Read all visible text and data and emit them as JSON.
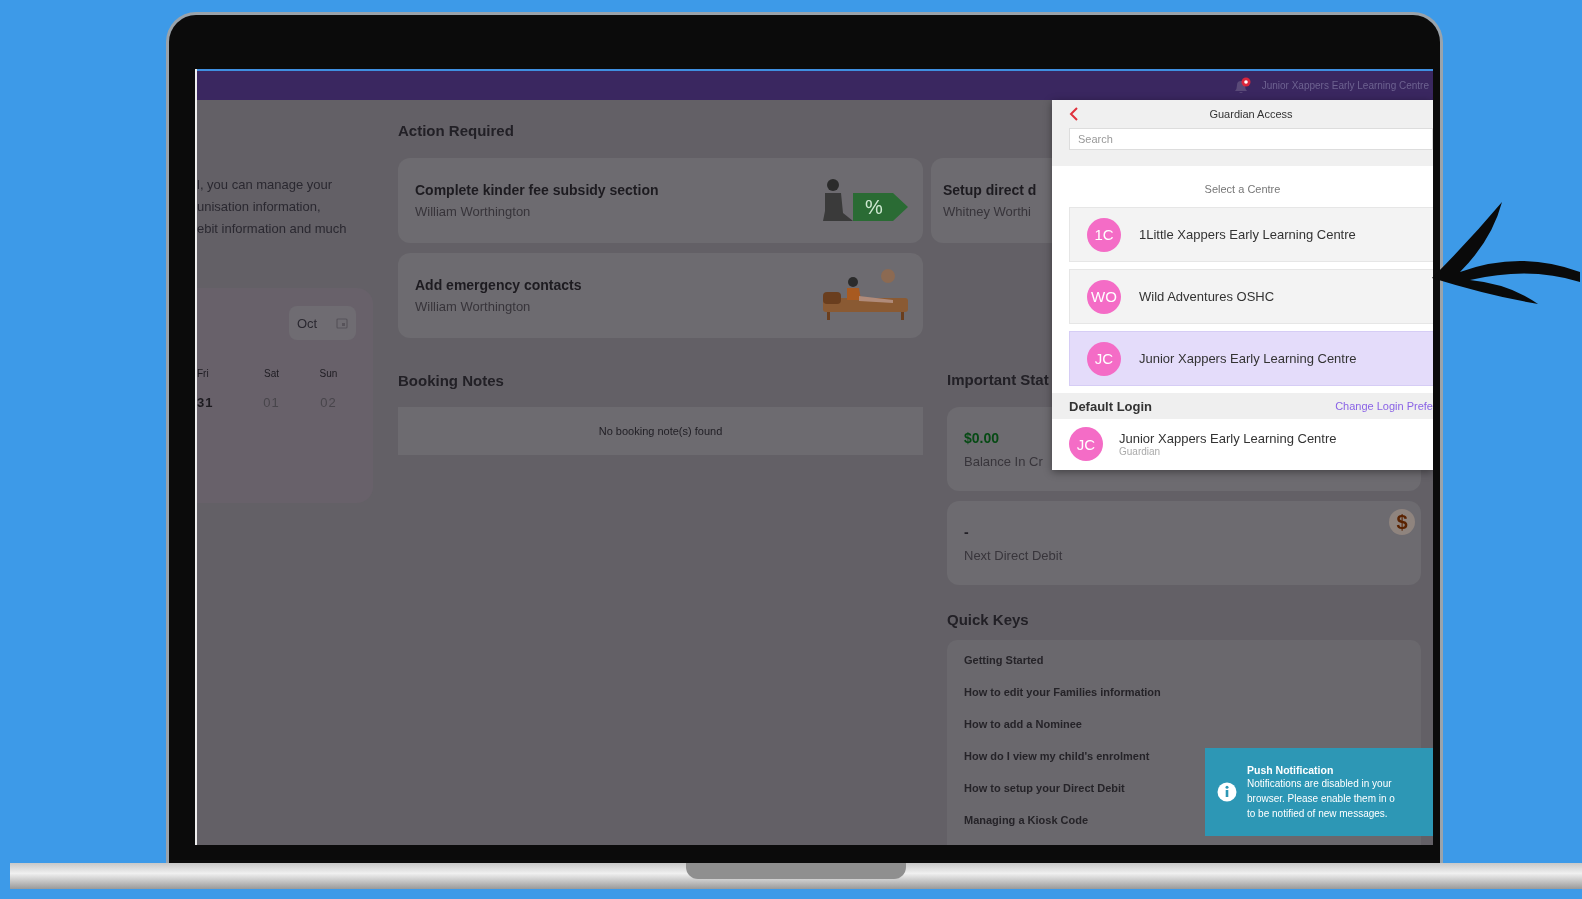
{
  "top_bar": {
    "centre_name": "Junior Xappers Early Learning Centre",
    "notification_badge": true
  },
  "intro_lines": [
    "l, you can manage your",
    "unisation information,",
    "ebit information and much"
  ],
  "calendar": {
    "month": "Oct",
    "days": [
      {
        "weekday": "Fri",
        "date": "31",
        "faded": false
      },
      {
        "weekday": "Sat",
        "date": "01",
        "faded": true
      },
      {
        "weekday": "Sun",
        "date": "02",
        "faded": true
      }
    ]
  },
  "action_required": {
    "title": "Action Required",
    "cards": [
      {
        "title": "Complete kinder fee subsidy section",
        "person": "William Worthington",
        "kind": "tag",
        "tag_text": "%"
      },
      {
        "title": "Setup direct d",
        "person": "Whitney Worthi",
        "kind": "plain"
      },
      {
        "title": "Add emergency contacts",
        "person": "William Worthington",
        "kind": "sofa"
      }
    ]
  },
  "booking_notes": {
    "title": "Booking Notes",
    "empty_message": "No booking note(s) found"
  },
  "important_stats": {
    "title": "Important Stat",
    "stats": [
      {
        "kind": "balance",
        "value": "$0.00",
        "label": "Balance In Cr"
      },
      {
        "kind": "debit",
        "value": "-",
        "label": "Next Direct Debit",
        "icon": "$"
      }
    ]
  },
  "quick_keys": {
    "title": "Quick Keys",
    "items": [
      "Getting Started",
      "How to edit your Families information",
      "How to add a Nominee",
      "How do I view my child's enrolment",
      "How to setup your Direct Debit",
      "Managing a Kiosk Code"
    ]
  },
  "guardian_access": {
    "title": "Guardian Access",
    "search_placeholder": "Search",
    "select_label": "Select a Centre",
    "centres": [
      {
        "initials": "1C",
        "name": "1Little Xappers Early Learning Centre",
        "selected": false
      },
      {
        "initials": "WO",
        "name": "Wild Adventures OSHC",
        "selected": false
      },
      {
        "initials": "JC",
        "name": "Junior Xappers Early Learning Centre",
        "selected": true
      }
    ],
    "default_login": {
      "title": "Default Login",
      "change_link": "Change Login Prefe",
      "initials": "JC",
      "name": "Junior Xappers Early Learning Centre",
      "role": "Guardian"
    }
  },
  "push_notification": {
    "title": "Push Notification",
    "lines": [
      "Notifications are disabled in your",
      "browser. Please enable them in o",
      "to be notified of new messages."
    ]
  }
}
